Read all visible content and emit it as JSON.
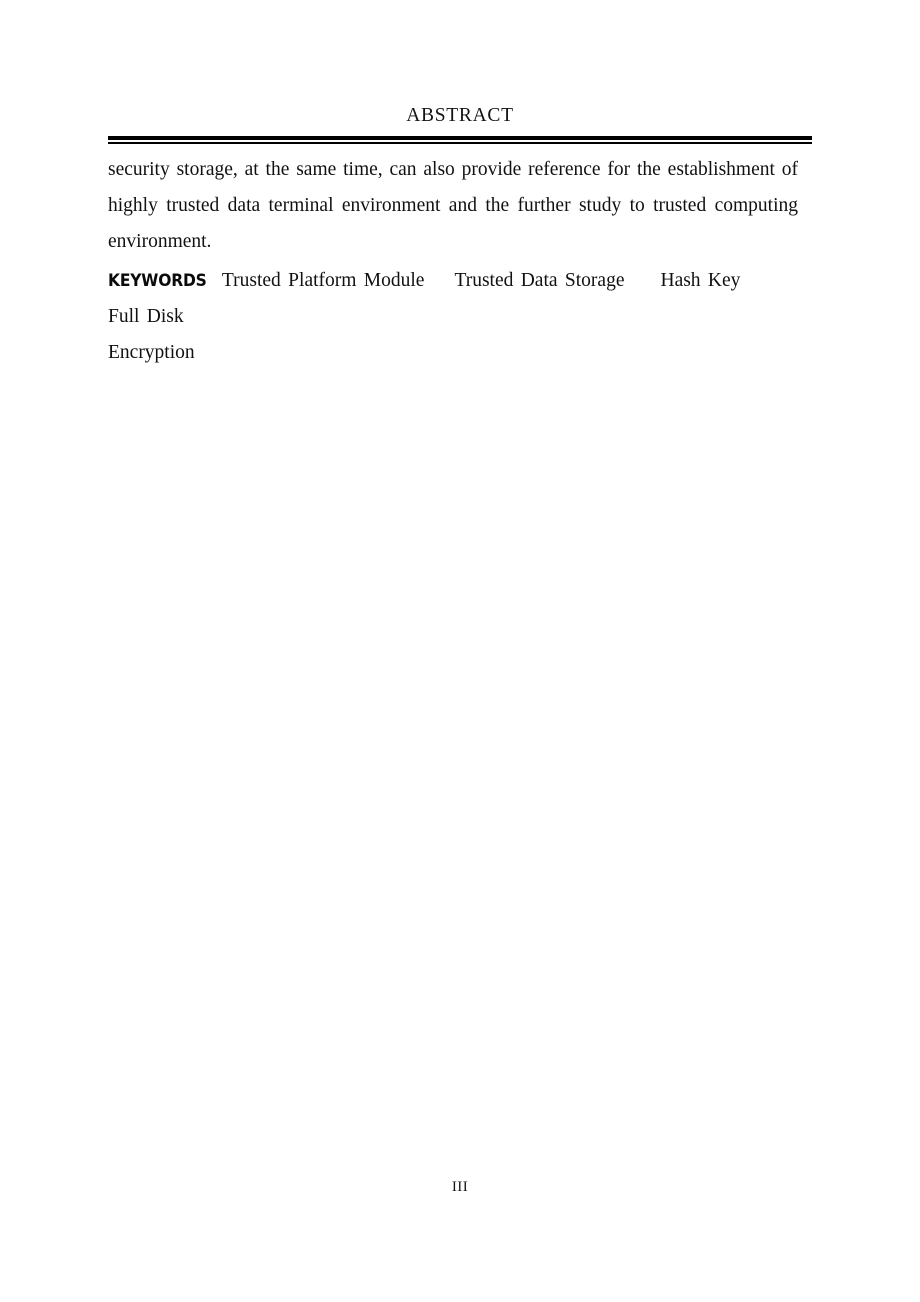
{
  "document": {
    "page_type": "abstract",
    "header_title": "ABSTRACT",
    "folio": "III"
  },
  "header": {
    "title": "ABSTRACT"
  },
  "body": {
    "paragraph_continuation": "security storage, at the same time, can also provide reference for the establishment of highly trusted data terminal environment and the further study to trusted computing environment."
  },
  "keywords": {
    "label": "KEYWORDS",
    "terms": [
      "Trusted Platform Module",
      "Trusted Data Storage",
      "Hash Key",
      "Full Disk Encryption"
    ],
    "line1_terms": [
      "Trusted Platform Module",
      "Trusted Data Storage",
      "Hash Key",
      "Full Disk"
    ],
    "line2_text": "Encryption"
  },
  "footer": {
    "page_number": "III"
  },
  "colors": {
    "page_background": "#ffffff",
    "text": "#111111",
    "rule": "#000000"
  }
}
